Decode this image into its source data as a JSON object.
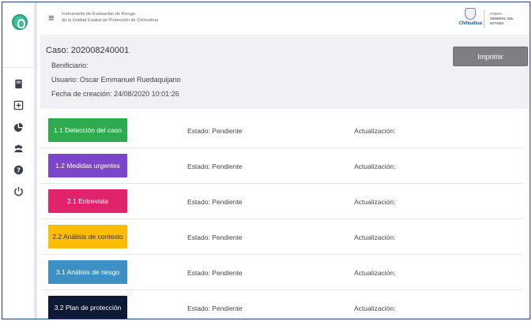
{
  "app": {
    "title_line1": "Instrumento de Evaluación de Riesgo",
    "title_line2": "de la Unidad Estatal de Protección de Chihuahua",
    "brand_name": "Chihuahua",
    "department_line1": "PODER",
    "department_line2": "GENERAL DEL ESTADO"
  },
  "sidebar": {
    "icons": [
      "app-logo-icon",
      "document-icon",
      "plus-box-icon",
      "pie-chart-icon",
      "users-icon",
      "help-icon",
      "power-icon"
    ]
  },
  "case": {
    "id_label": "Caso: 202008240001",
    "beneficiary_label": "Benificiario:",
    "user_label": "Usuario: Oscar Emmanuel Ruedaquijano",
    "created_label": "Fecha de creación: 24/08/2020 10:01:26",
    "print_label": "Imprimir"
  },
  "stages": [
    {
      "label": "1.1 Detección del caso",
      "status": "Estado: Pendiente",
      "update": "Actualización:",
      "color": "#2eaa4f"
    },
    {
      "label": "1.2 Medidas urgentes",
      "status": "Estado: Pendiente",
      "update": "Actualización:",
      "color": "#7b45cc"
    },
    {
      "label": "2.1 Entrevista",
      "status": "Estado: Pendiente",
      "update": "Actualización:",
      "color": "#e0236b"
    },
    {
      "label": "2.2 Análisis de contexto",
      "status": "Estado: Pendiente",
      "update": "Actualización:",
      "color": "#fbbc05"
    },
    {
      "label": "3.1 Análisis de riesgo",
      "status": "Estado: Pendiente",
      "update": "Actualización:",
      "color": "#3e8fc2"
    },
    {
      "label": "3.2 Plan de protección",
      "status": "Estado: Pendiente",
      "update": "Actualización:",
      "color": "#0e1a35"
    }
  ]
}
